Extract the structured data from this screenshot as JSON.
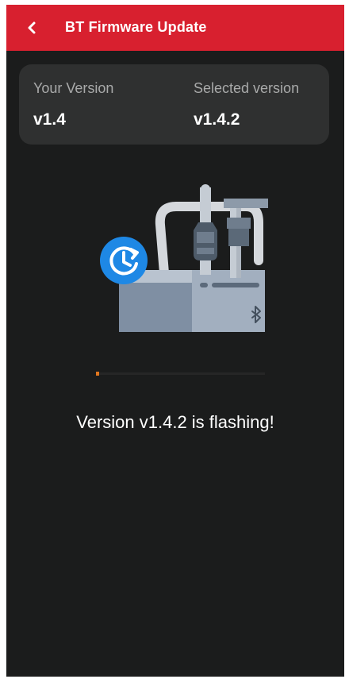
{
  "header": {
    "title": "BT Firmware Update"
  },
  "versions": {
    "current_label": "Your Version",
    "current_value": "v1.4",
    "selected_label": "Selected version",
    "selected_value": "v1.4.2"
  },
  "progress": {
    "fraction": 0.02
  },
  "status": {
    "message": "Version v1.4.2 is flashing!"
  },
  "colors": {
    "appbar": "#d8202f",
    "background": "#1b1c1c",
    "card": "#2f3030",
    "progress": "#e2771f",
    "update_badge": "#1e88e5"
  },
  "icons": {
    "back": "chevron-left-icon",
    "update": "update-clock-icon",
    "bluetooth": "bluetooth-icon"
  }
}
